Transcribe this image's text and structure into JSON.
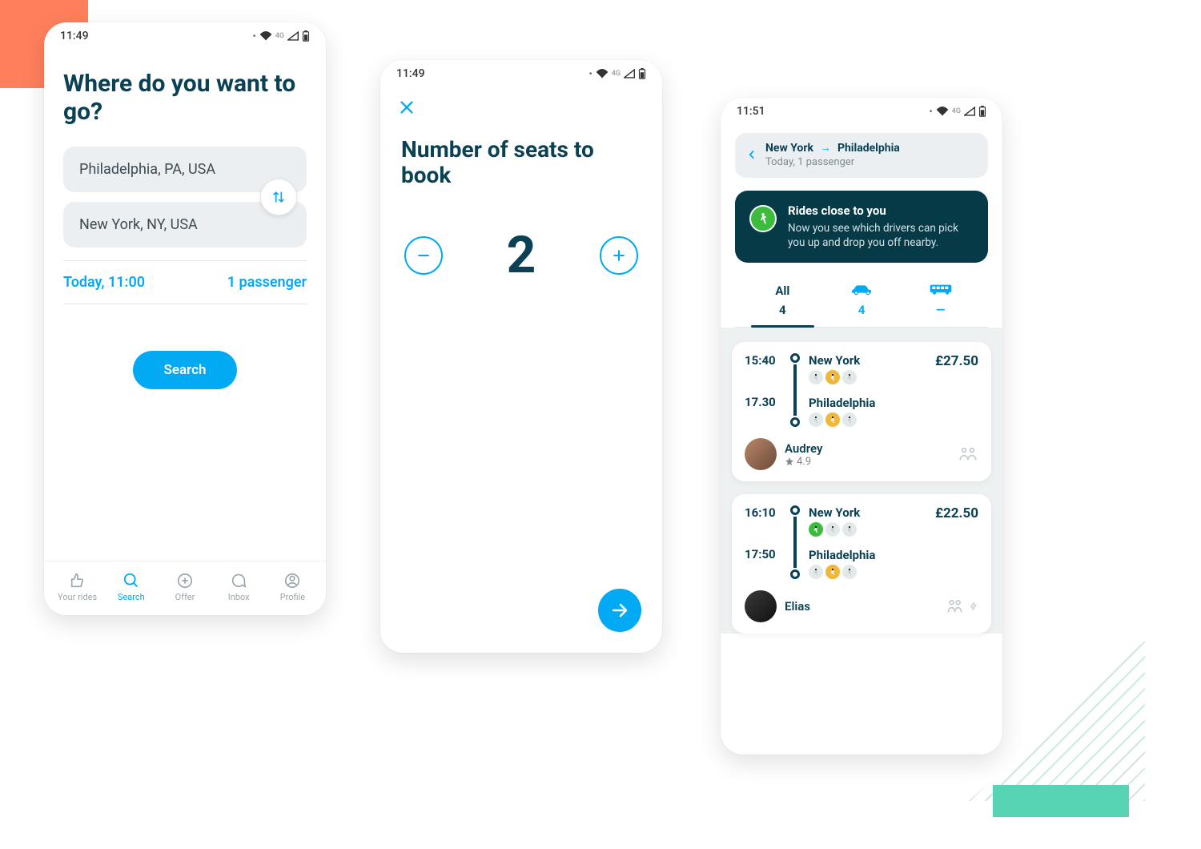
{
  "statusbar": {
    "time_a": "11:49",
    "time_b": "11:49",
    "time_c": "11:51",
    "net": "4G"
  },
  "screen1": {
    "title": "Where do you want to go?",
    "from": "Philadelphia, PA, USA",
    "to": "New York, NY, USA",
    "datetime": "Today, 11:00",
    "passengers": "1 passenger",
    "search_label": "Search",
    "tabs": {
      "rides": "Your rides",
      "search": "Search",
      "offer": "Offer",
      "inbox": "Inbox",
      "profile": "Profile"
    }
  },
  "screen2": {
    "title": "Number of seats to book",
    "value": "2"
  },
  "screen3": {
    "summary": {
      "from": "New York",
      "to": "Philadelphia",
      "sub": "Today, 1 passenger"
    },
    "info": {
      "title": "Rides close to you",
      "body": "Now you see which drivers can pick you up and drop you off nearby."
    },
    "filters": {
      "all_label": "All",
      "all_count": "4",
      "car_count": "4",
      "bus_count": "—"
    },
    "rides": [
      {
        "depart_time": "15:40",
        "arrive_time": "17.30",
        "from": "New York",
        "to": "Philadelphia",
        "from_walk": "yellow",
        "to_walk": "yellow",
        "price": "£27.50",
        "driver": "Audrey",
        "rating": "4.9",
        "capacity_icon": "two"
      },
      {
        "depart_time": "16:10",
        "arrive_time": "17:50",
        "from": "New York",
        "to": "Philadelphia",
        "from_walk": "green",
        "to_walk": "yellow",
        "price": "£22.50",
        "driver": "Elias",
        "rating": "",
        "capacity_icon": "two-bolt"
      }
    ]
  }
}
